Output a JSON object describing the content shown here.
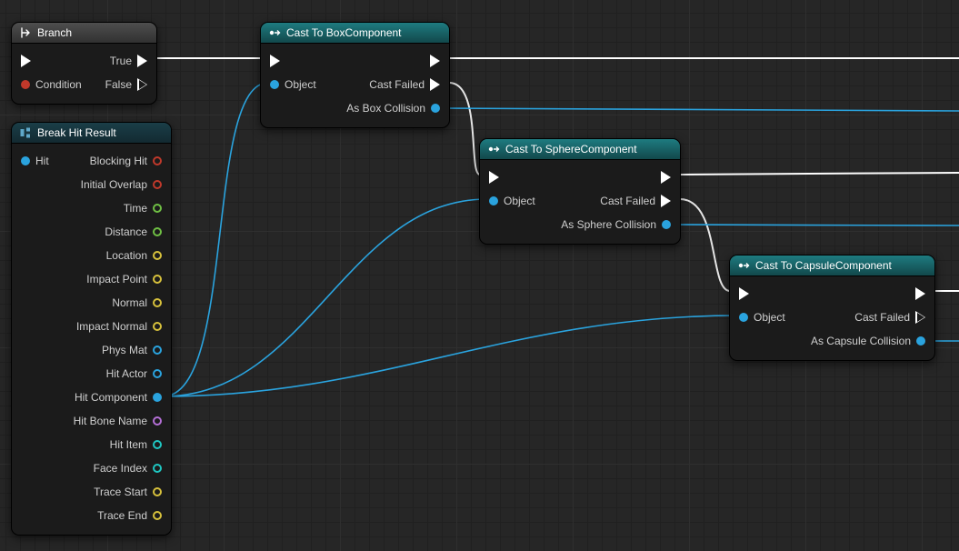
{
  "nodes": {
    "branch": {
      "title": "Branch",
      "out_true": "True",
      "out_false": "False",
      "in_cond": "Condition"
    },
    "break": {
      "title": "Break Hit Result",
      "in_hit": "Hit",
      "out": [
        "Blocking Hit",
        "Initial Overlap",
        "Time",
        "Distance",
        "Location",
        "Impact Point",
        "Normal",
        "Impact Normal",
        "Phys Mat",
        "Hit Actor",
        "Hit Component",
        "Hit Bone Name",
        "Hit Item",
        "Face Index",
        "Trace Start",
        "Trace End"
      ]
    },
    "cast_box": {
      "title": "Cast To BoxComponent",
      "in_obj": "Object",
      "out_fail": "Cast Failed",
      "out_as": "As Box Collision"
    },
    "cast_sphere": {
      "title": "Cast To SphereComponent",
      "in_obj": "Object",
      "out_fail": "Cast Failed",
      "out_as": "As Sphere Collision"
    },
    "cast_capsule": {
      "title": "Cast To CapsuleComponent",
      "in_obj": "Object",
      "out_fail": "Cast Failed",
      "out_as": "As Capsule Collision"
    }
  },
  "pin_colors": {
    "struct": "blue",
    "bool": "red",
    "float": "green",
    "vector": "yellow",
    "name": "purple",
    "int": "cyan",
    "object": "blue"
  }
}
